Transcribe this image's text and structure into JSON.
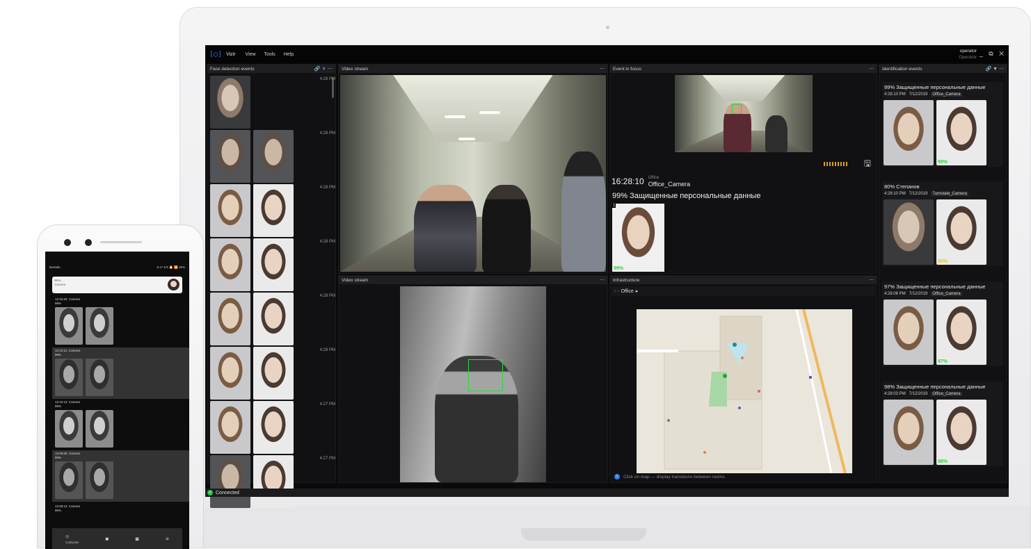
{
  "app": {
    "name": "Vizir",
    "menu": [
      "View",
      "Tools",
      "Help"
    ],
    "user": {
      "name": "operator",
      "role": "Operator"
    },
    "window_controls": "_ ⧉ ✕"
  },
  "panels": {
    "face_detection": {
      "title": "Face detection events",
      "times": [
        "4:28 PM",
        "4:28 PM",
        "4:28 PM",
        "4:28 PM",
        "4:28 PM",
        "4:28 PM",
        "4:27 PM",
        "4:27 PM"
      ]
    },
    "video_top": {
      "title": "Video stream"
    },
    "video_bottom": {
      "title": "Video stream"
    },
    "event_focus": {
      "title": "Event in focus",
      "time": "16:28:10",
      "location": "Office",
      "camera": "Office_Camera",
      "match": "99% Защищенные персональные данные",
      "badge_index": "1",
      "badge_pct": "99%"
    },
    "infrastructure": {
      "title": "Infrastructure",
      "breadcrumb": "Office",
      "note": "Click on map — display transitions between rooms"
    },
    "identification": {
      "title": "Identification events",
      "cards": [
        {
          "title": "99% Защищенные персональные данные",
          "time": "4:28:10 PM",
          "date": "7/12/2019",
          "camera": "Office_Camera",
          "pct": "99%"
        },
        {
          "title": "80% Степанов",
          "time": "4:28:10 PM",
          "date": "7/12/2019",
          "camera": "Turnstale_Camera",
          "pct": "80%"
        },
        {
          "title": "97% Защищенные персональные данные",
          "time": "4:28:08 PM",
          "date": "7/12/2019",
          "camera": "Office_Camera",
          "pct": "97%"
        },
        {
          "title": "98% Защищенные персональные данные",
          "time": "4:28:03 PM",
          "date": "7/12/2019",
          "camera": "Office_Camera",
          "pct": "98%"
        }
      ]
    }
  },
  "status": {
    "text": "Connected"
  },
  "phone": {
    "carrier": "Билайн",
    "status_right": "9.17 K/s ⏰ 📶 35%",
    "notification": {
      "line1": "99%...",
      "line2": "Camera"
    },
    "events": [
      {
        "time": "12:10:28",
        "camera": "Camera",
        "pct": "98%"
      },
      {
        "time": "12:10:21",
        "camera": "Camera",
        "pct": "99%"
      },
      {
        "time": "12:10:13",
        "camera": "Camera",
        "pct": "99%"
      },
      {
        "time": "12:09:06",
        "camera": "Camera",
        "pct": "99%"
      },
      {
        "time": "12:09:13",
        "camera": "Camera",
        "pct": "95%"
      }
    ],
    "nav_label": "События"
  },
  "colors": {
    "accent": "#2d86f5",
    "ok": "#29c24a",
    "match": "#2ed244",
    "bbox": "#27d93c"
  }
}
